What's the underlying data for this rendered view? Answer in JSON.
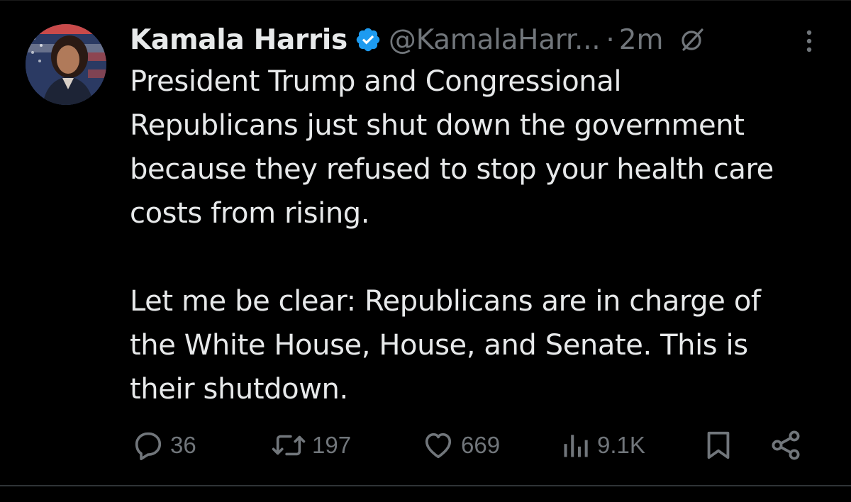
{
  "tweet": {
    "author": {
      "display_name": "Kamala Harris",
      "handle": "@KamalaHarr...",
      "verified": true
    },
    "separator": "·",
    "time": "2m",
    "text_paragraph_1": [
      "President Trump and Congressional",
      "Republicans just shut down the government",
      "because they refused to stop your health care",
      "costs from rising."
    ],
    "text_paragraph_2": [
      "Let me be clear: Republicans are in charge of",
      "the White House, House, and Senate. This is",
      "their shutdown."
    ],
    "actions": {
      "replies": "36",
      "reposts": "197",
      "likes": "669",
      "views": "9.1K"
    }
  },
  "colors": {
    "background": "#000000",
    "primary_text": "#e7e9ea",
    "secondary_text": "#71767b",
    "verified_blue": "#1d9bf0",
    "divider": "#2f3336"
  },
  "icons": {
    "verified": "verified-badge-icon",
    "grok": "grok-icon",
    "more": "more-dots-icon",
    "reply": "reply-icon",
    "repost": "repost-icon",
    "like": "heart-icon",
    "views": "views-chart-icon",
    "bookmark": "bookmark-icon",
    "share": "share-icon"
  }
}
